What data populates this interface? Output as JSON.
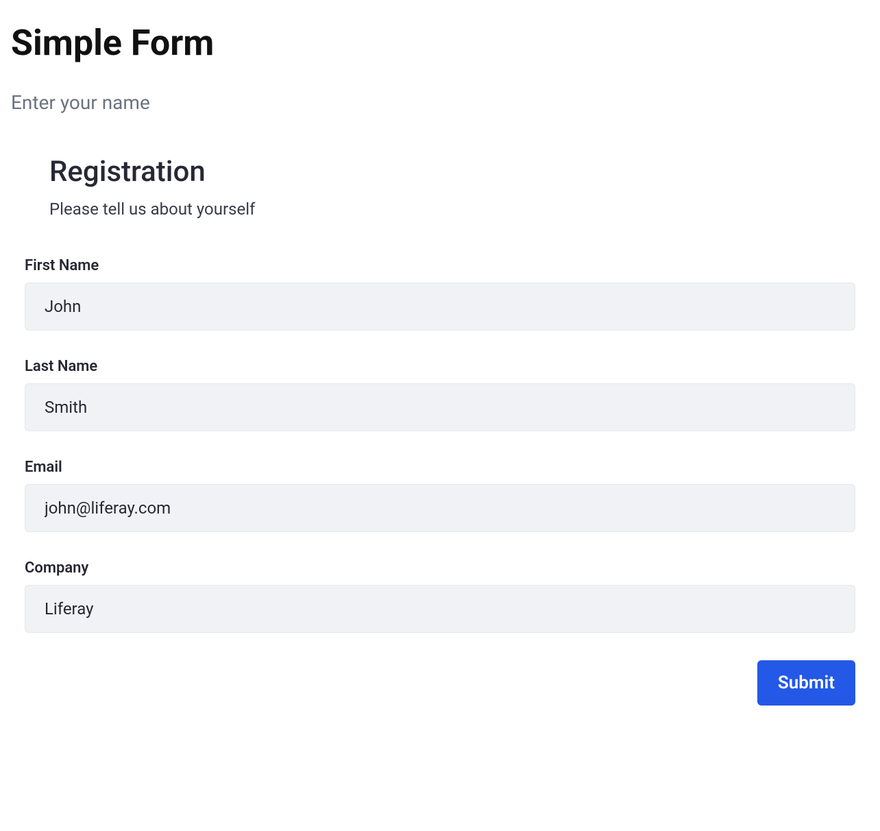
{
  "page": {
    "title": "Simple Form",
    "subtitle": "Enter your name"
  },
  "form": {
    "heading": "Registration",
    "subheading": "Please tell us about yourself",
    "fields": {
      "first_name": {
        "label": "First Name",
        "value": "John"
      },
      "last_name": {
        "label": "Last Name",
        "value": "Smith"
      },
      "email": {
        "label": "Email",
        "value": "john@liferay.com"
      },
      "company": {
        "label": "Company",
        "value": "Liferay"
      }
    },
    "submit_label": "Submit"
  }
}
